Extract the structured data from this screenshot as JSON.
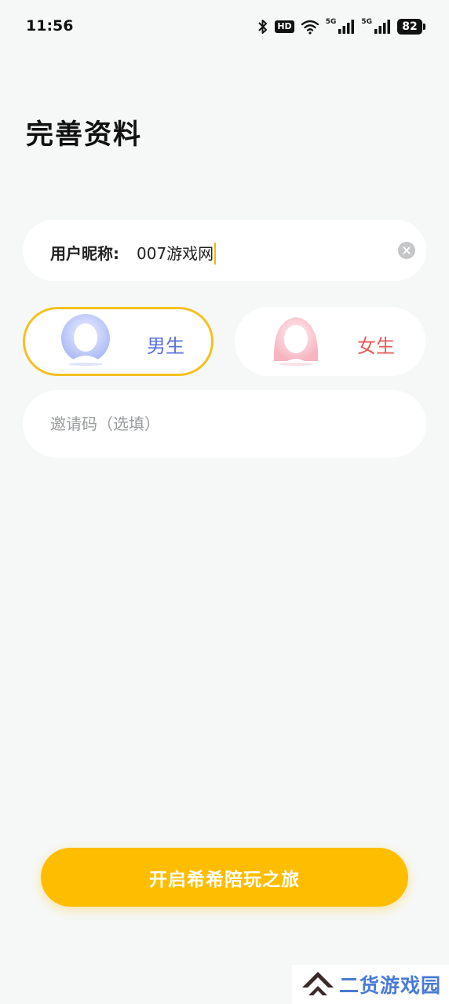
{
  "status_bar": {
    "time": "11:56",
    "hd_badge": "HD",
    "network_1": "5G",
    "network_2": "5G",
    "battery": "82",
    "icons": [
      "bluetooth-icon",
      "wifi-icon",
      "signal-icon",
      "signal-icon",
      "battery-icon"
    ]
  },
  "page": {
    "title": "完善资料"
  },
  "nickname": {
    "label": "用户昵称:",
    "value": "007游戏网"
  },
  "gender": {
    "male_label": "男生",
    "female_label": "女生",
    "selected": "male",
    "colors": {
      "male": "#5a70e0",
      "female": "#e95a5a",
      "selected_border": "#f5c020"
    }
  },
  "invite": {
    "placeholder": "邀请码（选填）"
  },
  "submit": {
    "label": "开启希希陪玩之旅",
    "color": "#ffbd00"
  },
  "watermark": {
    "text": "二货游戏园"
  }
}
